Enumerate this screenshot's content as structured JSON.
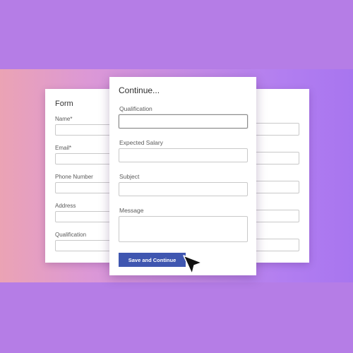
{
  "left_card": {
    "title": "Form",
    "fields": [
      {
        "label": "Name*"
      },
      {
        "label": "Email*"
      },
      {
        "label": "Phone Number"
      },
      {
        "label": "Address"
      },
      {
        "label": "Qualification"
      }
    ]
  },
  "middle_card": {
    "title": "Continue...",
    "fields": [
      {
        "label": "Qualification",
        "value": ""
      },
      {
        "label": "Expected Salary",
        "value": ""
      },
      {
        "label": "Subject",
        "value": ""
      },
      {
        "label": "Message",
        "value": ""
      }
    ],
    "button_label": "Save and Continue"
  },
  "colors": {
    "background": "#b57de6",
    "button": "#3f56b0",
    "band_start": "#eba3b4",
    "band_end": "#a875ef"
  },
  "icons": {
    "cursor": "mouse-pointer-icon"
  }
}
